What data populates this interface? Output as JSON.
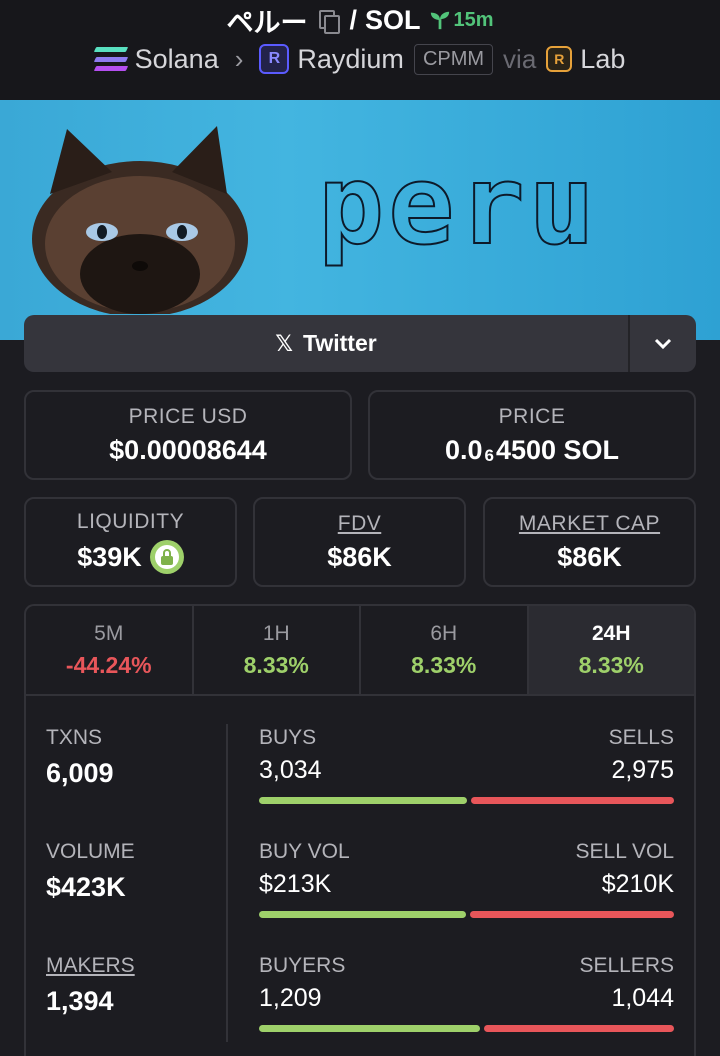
{
  "header": {
    "token": "ペルー",
    "quote": "SOL",
    "pair_sep": "/",
    "age": "15m",
    "chain": "Solana",
    "dex": "Raydium",
    "pool_type": "CPMM",
    "via": "via",
    "launchpad": "Lab"
  },
  "banner": {
    "text": "peru"
  },
  "twitter": {
    "label": "Twitter"
  },
  "cards": {
    "price_usd": {
      "label": "PRICE USD",
      "value": "$0.00008644"
    },
    "price": {
      "label": "PRICE",
      "prefix": "0.0",
      "zeros": "6",
      "suffix": "4500 SOL"
    },
    "liquidity": {
      "label": "LIQUIDITY",
      "value": "$39K"
    },
    "fdv": {
      "label": "FDV",
      "value": "$86K"
    },
    "market_cap": {
      "label": "MARKET CAP",
      "value": "$86K"
    }
  },
  "tabs": [
    {
      "label": "5M",
      "value": "-44.24%",
      "status": "neg"
    },
    {
      "label": "1H",
      "value": "8.33%",
      "status": "pos"
    },
    {
      "label": "6H",
      "value": "8.33%",
      "status": "pos"
    },
    {
      "label": "24H",
      "value": "8.33%",
      "status": "pos",
      "active": true
    }
  ],
  "stats": {
    "txns": {
      "label": "TXNS",
      "value": "6,009"
    },
    "volume": {
      "label": "VOLUME",
      "value": "$423K"
    },
    "makers": {
      "label": "MAKERS",
      "value": "1,394"
    },
    "buys": {
      "left_label": "BUYS",
      "right_label": "SELLS",
      "left": "3,034",
      "right": "2,975",
      "ratio": 0.505
    },
    "vol": {
      "left_label": "BUY VOL",
      "right_label": "SELL VOL",
      "left": "$213K",
      "right": "$210K",
      "ratio": 0.504
    },
    "makers_split": {
      "left_label": "BUYERS",
      "right_label": "SELLERS",
      "left": "1,209",
      "right": "1,044",
      "ratio": 0.537
    }
  },
  "colors": {
    "positive": "#9ed06a",
    "negative": "#e8565a",
    "background": "#1c1c21"
  }
}
